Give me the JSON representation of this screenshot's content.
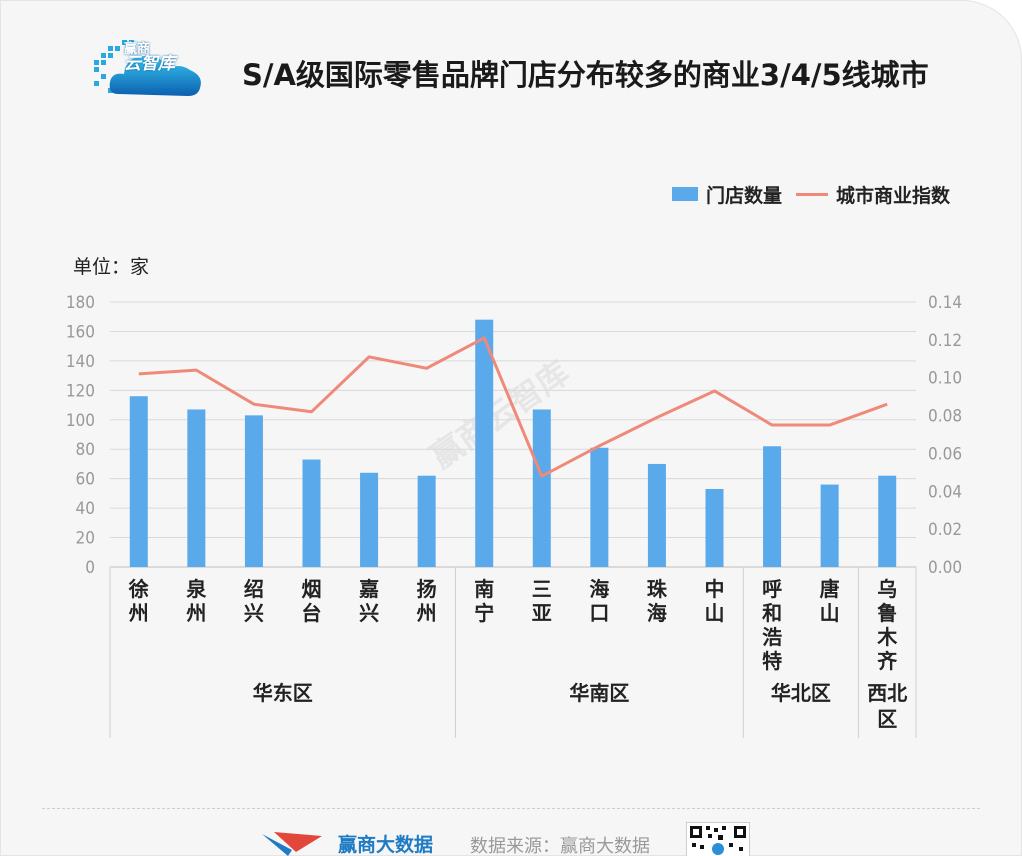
{
  "header": {
    "title": "S/A级国际零售品牌门店分布较多的商业3/4/5线城市",
    "logo": {
      "line1": "赢商",
      "line2": "云智库"
    }
  },
  "unit_label": "单位：家",
  "watermark": "赢商云智库",
  "footer": {
    "brand": "赢商大数据",
    "source": "数据来源：赢商大数据"
  },
  "colors": {
    "bar": "#5aa9ea",
    "line": "#ef8a7a",
    "axis_text": "#999999"
  },
  "chart_data": {
    "type": "bar",
    "title": "S/A级国际零售品牌门店分布较多的商业3/4/5线城市",
    "categories": [
      "徐州",
      "泉州",
      "绍兴",
      "烟台",
      "嘉兴",
      "扬州",
      "南宁",
      "三亚",
      "海口",
      "珠海",
      "中山",
      "呼和浩特",
      "唐山",
      "乌鲁木齐"
    ],
    "regions": [
      {
        "name": "华东区",
        "count": 6
      },
      {
        "name": "华南区",
        "count": 5
      },
      {
        "name": "华北区",
        "count": 2
      },
      {
        "name": "西北区",
        "count": 1
      }
    ],
    "series": [
      {
        "name": "门店数量",
        "type": "bar",
        "axis": "left",
        "values": [
          116,
          107,
          103,
          73,
          64,
          62,
          168,
          107,
          81,
          70,
          53,
          82,
          56,
          62
        ]
      },
      {
        "name": "城市商业指数",
        "type": "line",
        "axis": "right",
        "values": [
          0.102,
          0.104,
          0.086,
          0.082,
          0.111,
          0.105,
          0.121,
          0.048,
          0.064,
          0.079,
          0.093,
          0.075,
          0.075,
          0.086
        ]
      }
    ],
    "y_left": {
      "min": 0,
      "max": 180,
      "ticks": [
        "0",
        "20",
        "40",
        "60",
        "80",
        "100",
        "120",
        "140",
        "160",
        "180"
      ]
    },
    "y_right": {
      "min": 0,
      "max": 0.14,
      "ticks": [
        "0.00",
        "0.02",
        "0.04",
        "0.06",
        "0.08",
        "0.10",
        "0.12",
        "0.14"
      ]
    },
    "grid": true,
    "legend_position": "top-right"
  }
}
